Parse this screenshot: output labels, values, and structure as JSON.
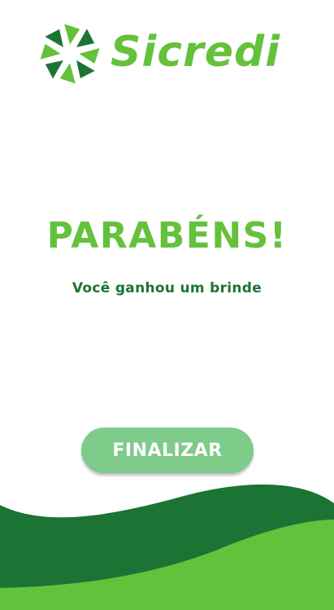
{
  "brand": {
    "name": "Sicredi",
    "logo_icon": "sicredi-pinwheel-icon"
  },
  "main": {
    "headline": "PARABÉNS!",
    "subtitle": "Você ganhou um brinde"
  },
  "actions": {
    "finish_label": "FINALIZAR"
  },
  "colors": {
    "brand_green": "#64c13c",
    "dark_green": "#1b7434",
    "button_green": "#7fcb8a",
    "background": "#ffffff"
  }
}
